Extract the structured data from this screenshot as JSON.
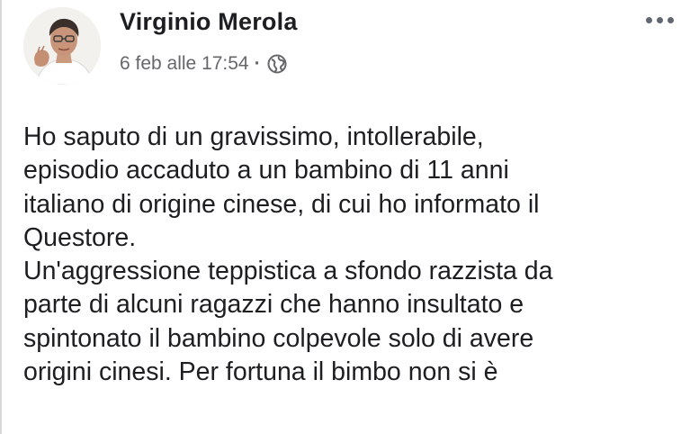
{
  "post": {
    "author": "Virginio Merola",
    "timestamp": "6 feb alle 17:54",
    "separator": "·",
    "audience_icon": "globe-icon",
    "menu_icon": "more-options-icon",
    "lines": [
      "Ho saputo di un gravissimo, intollerabile,",
      "episodio accaduto a un bambino di 11 anni",
      "italiano di origine cinese, di cui ho informato il",
      "Questore.",
      "Un'aggressione teppistica a sfondo razzista da",
      "parte di alcuni ragazzi che hanno insultato e",
      "spintonato il bambino colpevole solo di avere",
      "origini cinesi. Per fortuna il bimbo non si è"
    ]
  },
  "colors": {
    "text": "#1c1e21",
    "meta": "#65676b",
    "icon": "#606770",
    "background": "#ffffff"
  }
}
